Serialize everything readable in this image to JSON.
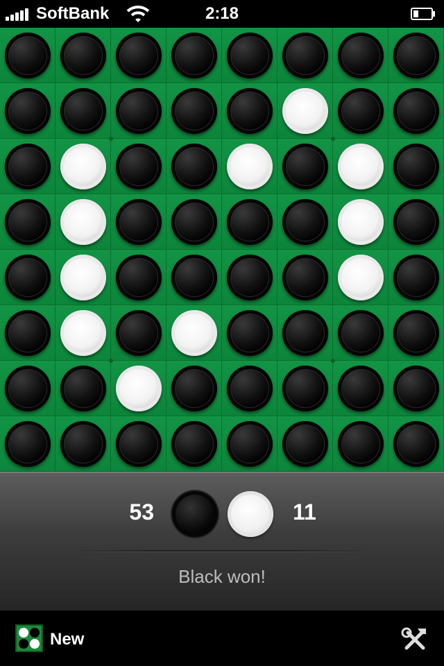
{
  "status_bar": {
    "carrier": "SoftBank",
    "time": "2:18"
  },
  "board": {
    "rows": [
      [
        "B",
        "B",
        "B",
        "B",
        "B",
        "B",
        "B",
        "B"
      ],
      [
        "B",
        "B",
        "B",
        "B",
        "B",
        "W",
        "B",
        "B"
      ],
      [
        "B",
        "W",
        "B",
        "B",
        "W",
        "B",
        "W",
        "B"
      ],
      [
        "B",
        "W",
        "B",
        "B",
        "B",
        "B",
        "W",
        "B"
      ],
      [
        "B",
        "W",
        "B",
        "B",
        "B",
        "B",
        "W",
        "B"
      ],
      [
        "B",
        "W",
        "B",
        "W",
        "B",
        "B",
        "B",
        "B"
      ],
      [
        "B",
        "B",
        "W",
        "B",
        "B",
        "B",
        "B",
        "B"
      ],
      [
        "B",
        "B",
        "B",
        "B",
        "B",
        "B",
        "B",
        "B"
      ]
    ]
  },
  "score": {
    "black": "53",
    "white": "11",
    "message": "Black won!"
  },
  "toolbar": {
    "new_label": "New"
  },
  "colors": {
    "board_green": "#0e8a3c",
    "black_disc": "#000000",
    "white_disc": "#ffffff"
  }
}
